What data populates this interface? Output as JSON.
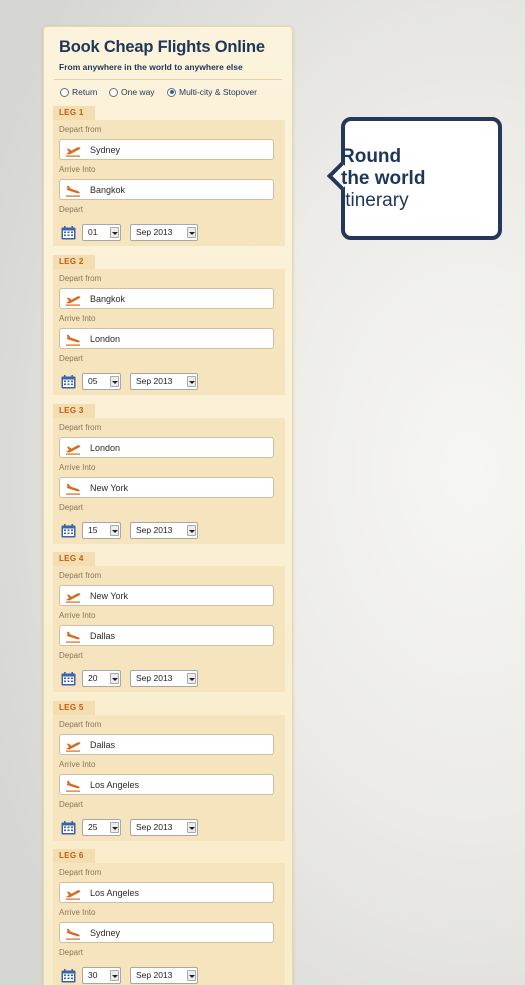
{
  "widget": {
    "title": "Book Cheap Flights Online",
    "subtitle": "From anywhere in the world to anywhere else",
    "trip_types": [
      {
        "label": "Return",
        "selected": false
      },
      {
        "label": "One way",
        "selected": false
      },
      {
        "label": "Multi-city & Stopover",
        "selected": true
      }
    ],
    "depart_from_label": "Depart from",
    "arrive_into_label": "Arrive Into",
    "depart_label": "Depart",
    "legs": [
      {
        "label": "LEG 1",
        "from": "Sydney",
        "to": "Bangkok",
        "day": "01",
        "month": "Sep 2013"
      },
      {
        "label": "LEG 2",
        "from": "Bangkok",
        "to": "London",
        "day": "05",
        "month": "Sep 2013"
      },
      {
        "label": "LEG 3",
        "from": "London",
        "to": "New York",
        "day": "15",
        "month": "Sep 2013"
      },
      {
        "label": "LEG 4",
        "from": "New York",
        "to": "Dallas",
        "day": "20",
        "month": "Sep 2013"
      },
      {
        "label": "LEG 5",
        "from": "Dallas",
        "to": "Los Angeles",
        "day": "25",
        "month": "Sep 2013"
      },
      {
        "label": "LEG 6",
        "from": "Los Angeles",
        "to": "Sydney",
        "day": "30",
        "month": "Sep 2013"
      }
    ]
  },
  "callout": {
    "line1": "Round",
    "line2": "the world",
    "line3": "itinerary"
  },
  "colors": {
    "navy": "#1e3657",
    "leg_label": "#c8590d",
    "plane_icon": "#d86a1a",
    "calendar_icon": "#3a63a8",
    "widget_bg": "#fcf3dc"
  },
  "icons": {
    "takeoff": "takeoff-plane-icon",
    "landing": "landing-plane-icon",
    "calendar": "calendar-icon",
    "dropdown": "chevron-down-icon"
  }
}
